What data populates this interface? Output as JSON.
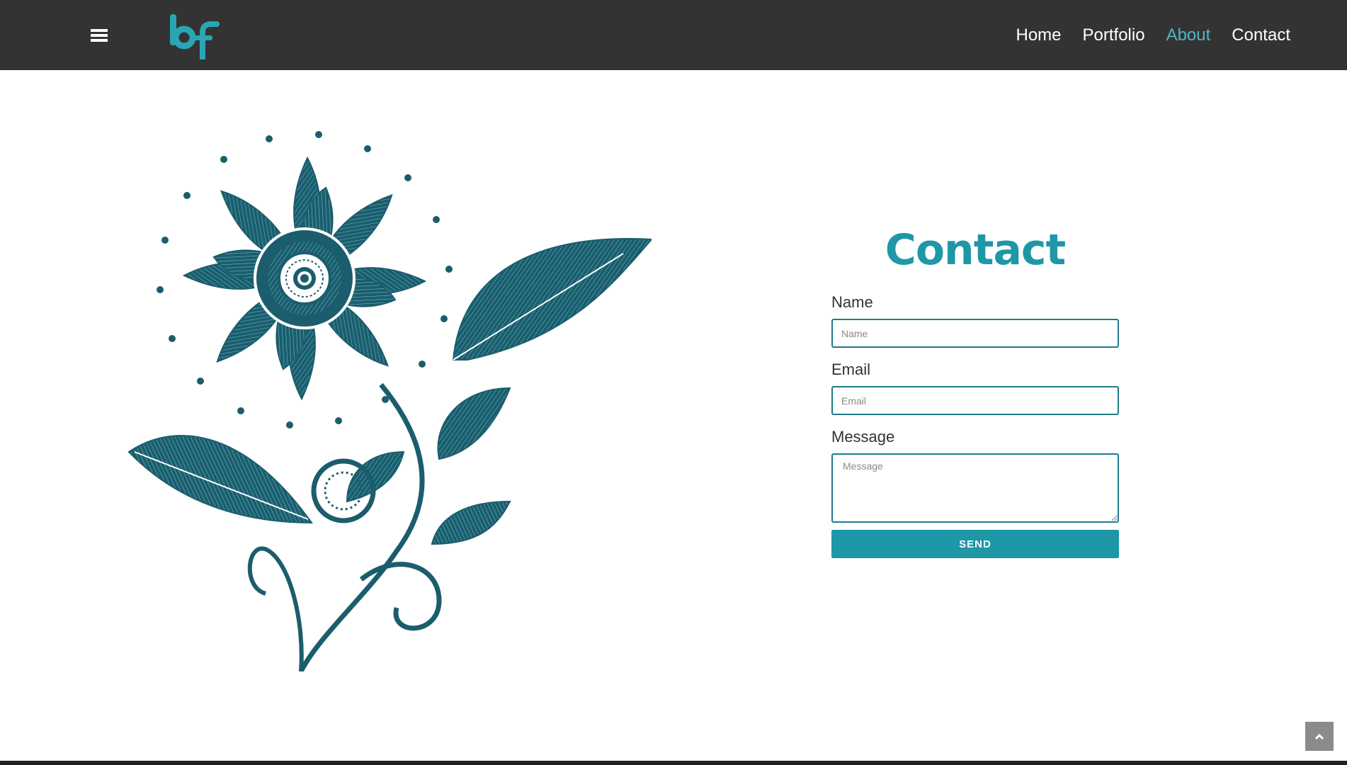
{
  "header": {
    "menu_icon": "hamburger-icon",
    "logo_text": "bf",
    "nav": [
      {
        "label": "Home",
        "active": false
      },
      {
        "label": "Portfolio",
        "active": false
      },
      {
        "label": "About",
        "active": true
      },
      {
        "label": "Contact",
        "active": false
      }
    ]
  },
  "main": {
    "illustration": "teal-flower-illustration",
    "contact": {
      "title": "Contact",
      "fields": {
        "name": {
          "label": "Name",
          "placeholder": "Name",
          "value": ""
        },
        "email": {
          "label": "Email",
          "placeholder": "Email",
          "value": ""
        },
        "message": {
          "label": "Message",
          "placeholder": "Message",
          "value": ""
        }
      },
      "send_label": "SEND"
    }
  },
  "scroll_top_icon": "chevron-up-icon",
  "colors": {
    "header_bg": "#333333",
    "accent": "#1e97a6",
    "nav_active": "#4fb7c7",
    "illustration": "#1b5d6d"
  }
}
